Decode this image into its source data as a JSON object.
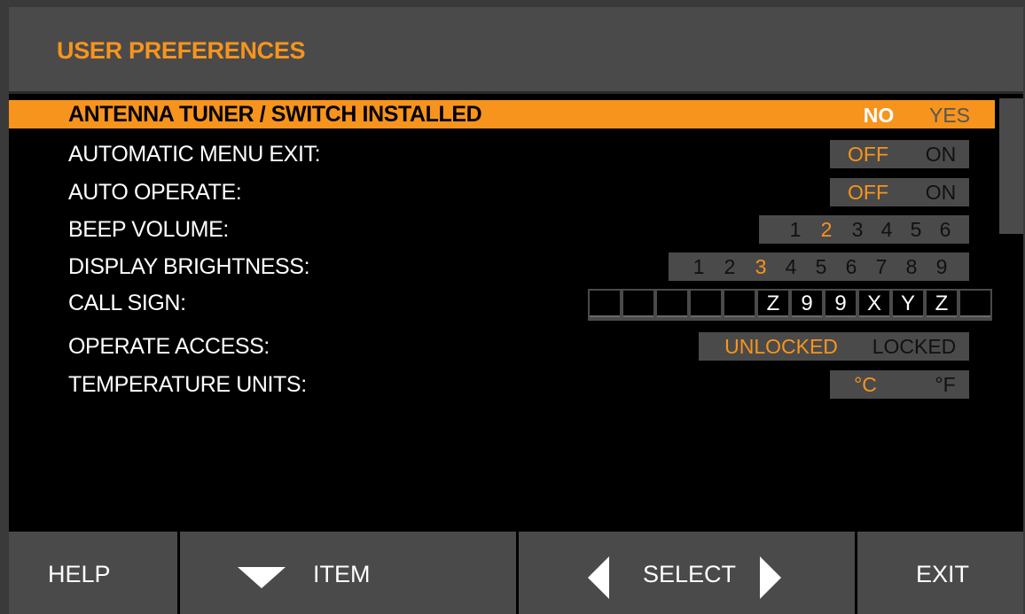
{
  "screen": {
    "title": "USER PREFERENCES"
  },
  "menu": {
    "items": [
      {
        "label": "ANTENNA TUNER / SWITCH INSTALLED",
        "options": [
          "NO",
          "YES"
        ],
        "selected": "NO",
        "highlighted": true
      },
      {
        "label": "AUTOMATIC MENU EXIT:",
        "options": [
          "OFF",
          "ON"
        ],
        "selected": "OFF"
      },
      {
        "label": "AUTO OPERATE:",
        "options": [
          "OFF",
          "ON"
        ],
        "selected": "OFF"
      },
      {
        "label": "BEEP VOLUME:",
        "options": [
          "1",
          "2",
          "3",
          "4",
          "5",
          "6"
        ],
        "selected": "2"
      },
      {
        "label": "DISPLAY BRIGHTNESS:",
        "options": [
          "1",
          "2",
          "3",
          "4",
          "5",
          "6",
          "7",
          "8",
          "9"
        ],
        "selected": "3"
      },
      {
        "label": "CALL SIGN:",
        "cells": [
          "",
          "",
          "",
          "",
          "",
          "Z",
          "9",
          "9",
          "X",
          "Y",
          "Z",
          ""
        ]
      },
      {
        "label": "OPERATE ACCESS:",
        "options": [
          "UNLOCKED",
          "LOCKED"
        ],
        "selected": "UNLOCKED"
      },
      {
        "label": "TEMPERATURE UNITS:",
        "options": [
          "°C",
          "°F"
        ],
        "selected": "°C"
      }
    ]
  },
  "softkeys": {
    "help": "HELP",
    "item": "ITEM",
    "select": "SELECT",
    "exit": "EXIT"
  },
  "colors": {
    "accent": "#f7941d",
    "panel": "#4a4a4a",
    "background": "#000000"
  }
}
